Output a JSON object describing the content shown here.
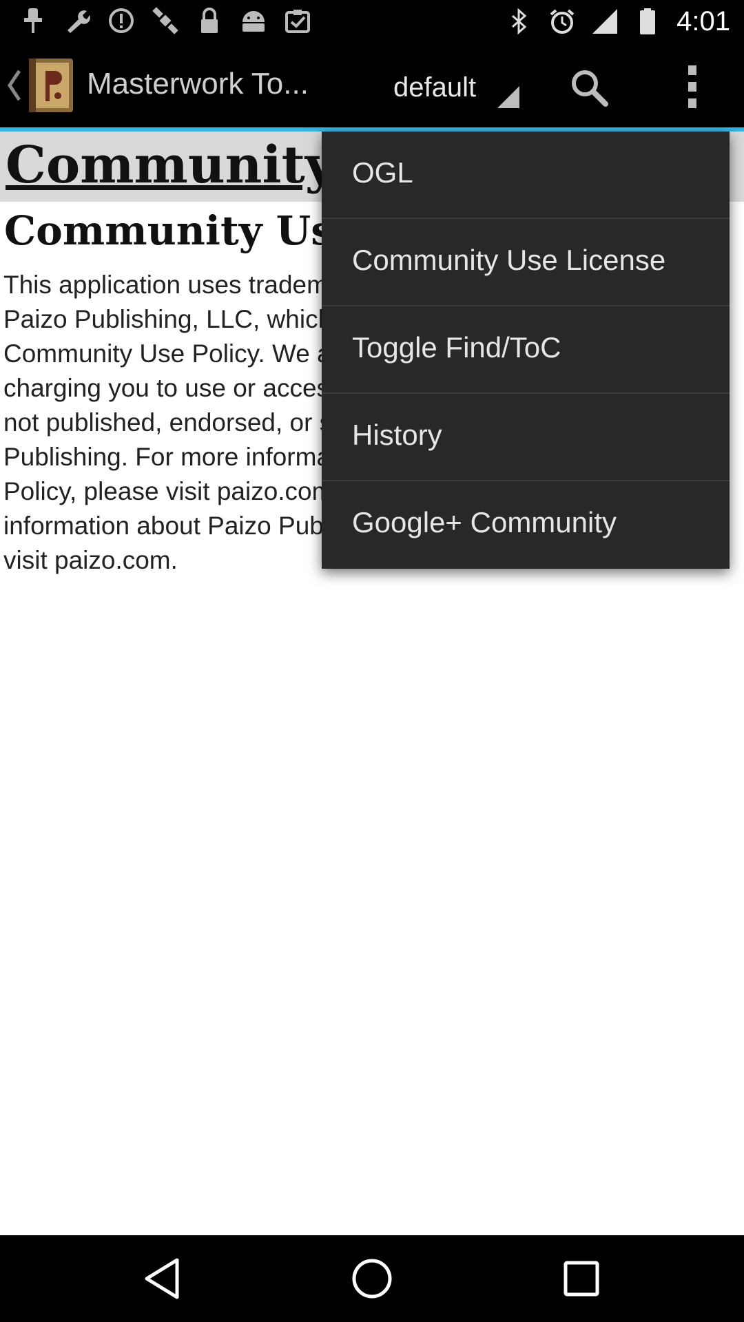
{
  "status_bar": {
    "time": "4:01",
    "left_icons": [
      "notification-pin-icon",
      "wrench-icon",
      "info-icon",
      "satellite-icon",
      "lock-icon",
      "android-icon",
      "clipboard-check-icon"
    ],
    "right_icons": [
      "bluetooth-icon",
      "alarm-icon",
      "signal-icon",
      "battery-icon"
    ]
  },
  "action_bar": {
    "title": "Masterwork To...",
    "spinner_value": "default",
    "icons": [
      "back-chevron-icon",
      "app-book-icon",
      "search-icon",
      "overflow-menu-icon"
    ]
  },
  "content": {
    "heading": "Community Use License",
    "subheading": "Community Use License",
    "body": "This application uses trademarks and/or copyrights owned by Paizo Publishing, LLC, which are used under Paizo's Community Use Policy. We are expressly prohibited from charging you to use or access this content. This application is not published, endorsed, or specifically approved by Paizo Publishing. For more information about Paizo's Community Use Policy, please visit paizo.com/communityuse. For more information about Paizo Publishing and Paizo products, please visit paizo.com."
  },
  "menu": {
    "items": [
      {
        "label": "OGL"
      },
      {
        "label": "Community Use License"
      },
      {
        "label": "Toggle Find/ToC"
      },
      {
        "label": "History"
      },
      {
        "label": "Google+ Community"
      }
    ]
  },
  "nav_bar": {
    "icons": [
      "back-triangle-icon",
      "home-circle-icon",
      "recents-square-icon"
    ]
  },
  "colors": {
    "accent": "#33b5e5",
    "menu_bg": "#282828",
    "bar_bg": "#000000"
  }
}
